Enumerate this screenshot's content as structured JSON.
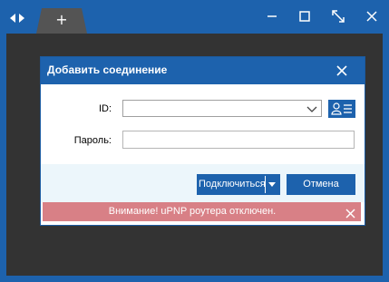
{
  "window": {
    "tab_plus": "+",
    "icons": {
      "nav": "left-right-arrows-icon",
      "minimize": "minimize-icon",
      "maximize": "maximize-icon",
      "fullscreen": "fullscreen-icon",
      "close": "close-icon"
    }
  },
  "dialog": {
    "title": "Добавить соединение",
    "id_label": "ID:",
    "id_value": "",
    "password_label": "Пароль:",
    "password_value": "",
    "connect_label": "Подключиться",
    "cancel_label": "Отмена",
    "warning_text": "Внимание! uPNP роутера отключен."
  },
  "colors": {
    "accent": "#1d62ad",
    "background": "#333333",
    "warning": "#d88086",
    "actions_bar": "#ecf6fb"
  }
}
